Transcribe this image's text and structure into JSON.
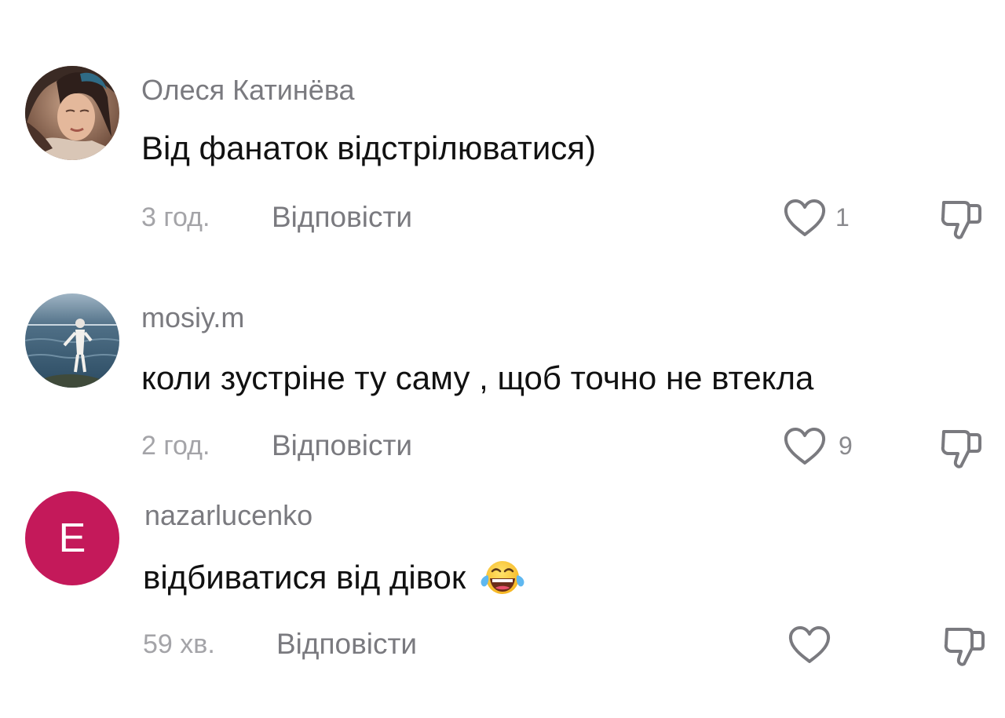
{
  "comments": [
    {
      "username": "Олеся Катинёва",
      "text": "Від фанаток відстрілюватися)",
      "time": "3 год.",
      "reply_label": "Відповісти",
      "likes": "1",
      "avatar_icon": "photo-avatar-woman"
    },
    {
      "username": "mosiy.m",
      "text": "коли зустріне ту саму , щоб точно не втекла",
      "time": "2 год.",
      "reply_label": "Відповісти",
      "likes": "9",
      "avatar_icon": "photo-avatar-lake"
    },
    {
      "username": "nazarlucenko",
      "text": "відбиватися від дівок",
      "emoji": "😂",
      "time": "59 хв.",
      "reply_label": "Відповісти",
      "likes": "",
      "avatar_letter": "E",
      "avatar_color": "#c4195a"
    }
  ],
  "colors": {
    "username": "#7a7a7f",
    "text": "#111111",
    "meta": "#a4a4a8",
    "icon_stroke": "#7a7a7f"
  }
}
